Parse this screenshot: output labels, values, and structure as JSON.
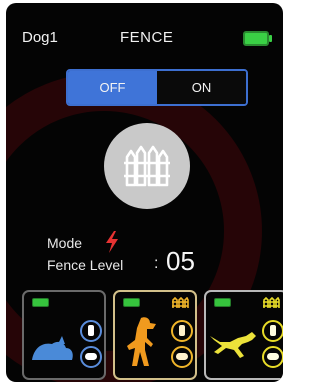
{
  "header": {
    "dog_name": "Dog1",
    "title": "FENCE",
    "battery_icon": "battery-full-icon"
  },
  "toggle": {
    "off_label": "OFF",
    "on_label": "ON",
    "selected": "OFF"
  },
  "fence_button": {
    "icon": "fence-icon"
  },
  "mode": {
    "label": "Mode",
    "icon": "lightning-bolt-icon"
  },
  "fence_level": {
    "label": "Fence Level",
    "separator": ":",
    "value": "05"
  },
  "dog_cards": [
    {
      "pose": "lying-dog-icon",
      "color": "#4a8ad8",
      "selected": false
    },
    {
      "pose": "standing-dog-icon",
      "color": "#f09a1e",
      "selected": true
    },
    {
      "pose": "leaping-dog-icon",
      "color": "#ece23a",
      "selected": false
    }
  ],
  "colors": {
    "accent": "#3f74d8",
    "background": "#040404",
    "battery": "#3ad045"
  }
}
